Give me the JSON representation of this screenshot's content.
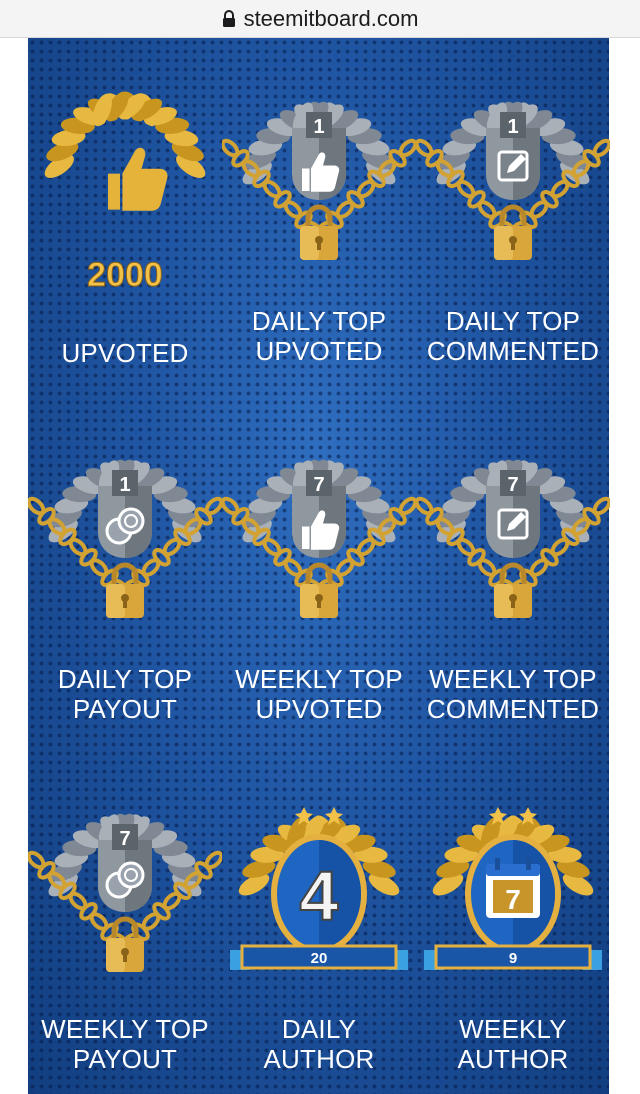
{
  "browser": {
    "url": "steemitboard.com"
  },
  "badges": [
    {
      "label_line1": "",
      "label_line2": "UPVOTED",
      "icon": "gold-laurel-thumbs-up-icon",
      "value": "2000"
    },
    {
      "label_line1": "DAILY TOP",
      "label_line2": "UPVOTED",
      "icon": "chained-trophy-thumbs-up-icon",
      "rank": "1"
    },
    {
      "label_line1": "DAILY TOP",
      "label_line2": "COMMENTED",
      "icon": "chained-trophy-comment-icon",
      "rank": "1"
    },
    {
      "label_line1": "DAILY TOP",
      "label_line2": "PAYOUT",
      "icon": "chained-trophy-coins-icon",
      "rank": "1"
    },
    {
      "label_line1": "WEEKLY TOP",
      "label_line2": "UPVOTED",
      "icon": "chained-trophy-thumbs-up-icon",
      "rank": "7"
    },
    {
      "label_line1": "WEEKLY TOP",
      "label_line2": "COMMENTED",
      "icon": "chained-trophy-comment-icon",
      "rank": "7"
    },
    {
      "label_line1": "WEEKLY TOP",
      "label_line2": "PAYOUT",
      "icon": "chained-trophy-coins-icon",
      "rank": "7"
    },
    {
      "label_line1": "DAILY",
      "label_line2": "AUTHOR",
      "icon": "author-medal-number-icon",
      "emblem": "4",
      "count": "20"
    },
    {
      "label_line1": "WEEKLY",
      "label_line2": "AUTHOR",
      "icon": "author-medal-calendar-icon",
      "emblem": "7",
      "count": "9"
    }
  ]
}
